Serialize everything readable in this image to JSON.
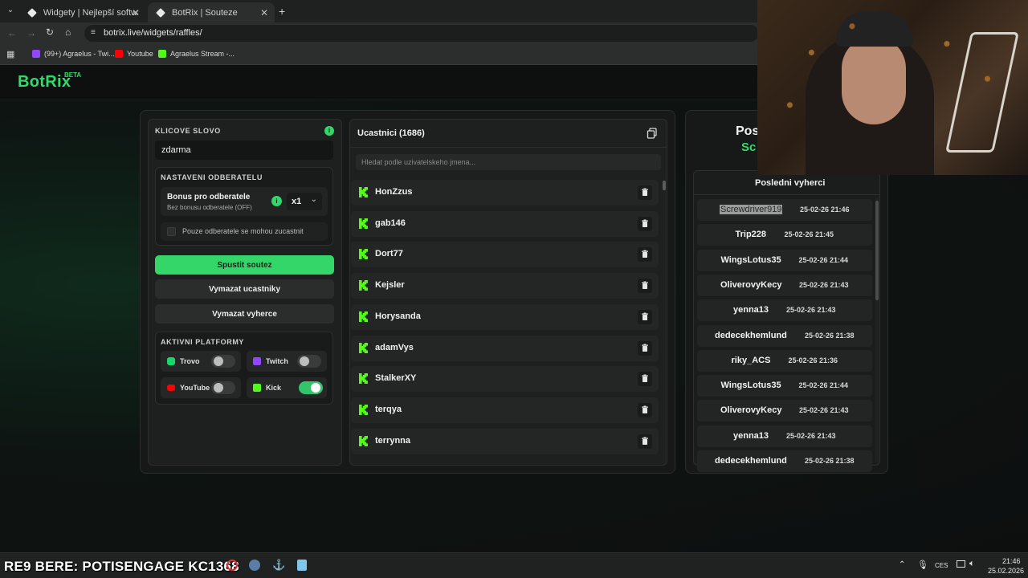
{
  "browser": {
    "tabs": [
      {
        "label": "Widgety | Nejlepší software pro",
        "active": false
      },
      {
        "label": "BotRix | Souteze",
        "active": true
      }
    ],
    "url": "botrix.live/widgets/raffles/",
    "bookmarks": [
      "(99+) Agraelus - Twi...",
      "Youtube",
      "Agraelus Stream -..."
    ]
  },
  "app": {
    "logo": "BotRix",
    "logo_badge": "BETA"
  },
  "left_panel": {
    "keyword_label": "KLICOVE SLOVO",
    "keyword_value": "zdarma",
    "subscriber_settings_label": "NASTAVENI ODBERATELU",
    "bonus_title": "Bonus pro odberatele",
    "bonus_subtitle": "Bez bonusu odberatele (OFF)",
    "bonus_multiplier": "x1",
    "subs_only_label": "Pouze odberatele se mohou zucastnit",
    "start_button": "Spustit soutez",
    "clear_participants_button": "Vymazat ucastniky",
    "clear_winners_button": "Vymazat vyherce",
    "platforms_label": "AKTIVNI PLATFORMY",
    "platforms": [
      {
        "name": "Trovo",
        "enabled": false,
        "color": "#19d66b"
      },
      {
        "name": "Twitch",
        "enabled": false,
        "color": "#9146ff"
      },
      {
        "name": "YouTube",
        "enabled": false,
        "color": "#ff0000"
      },
      {
        "name": "Kick",
        "enabled": true,
        "color": "#53fc18"
      }
    ]
  },
  "participants": {
    "title": "Ucastnici (1686)",
    "search_placeholder": "Hledat podle uzivatelskeho jmena...",
    "items": [
      "HonZzus",
      "gab146",
      "Dort77",
      "Kejsler",
      "Horysanda",
      "adamVys",
      "StalkerXY",
      "terqya",
      "terrynna"
    ]
  },
  "winners_panel": {
    "title_line1": "Pos",
    "title_line2": "Sc",
    "list_title": "Posledni vyherci",
    "items": [
      {
        "name": "Screwdriver919",
        "date": "25-02-26 21:46"
      },
      {
        "name": "Trip228",
        "date": "25-02-26 21:45"
      },
      {
        "name": "WingsLotus35",
        "date": "25-02-26 21:44"
      },
      {
        "name": "OliverovyKecy",
        "date": "25-02-26 21:43"
      },
      {
        "name": "yenna13",
        "date": "25-02-26 21:43"
      },
      {
        "name": "dedecekhemlund",
        "date": "25-02-26 21:38"
      },
      {
        "name": "riky_ACS",
        "date": "25-02-26 21:36"
      },
      {
        "name": "WingsLotus35",
        "date": "25-02-26 21:44"
      },
      {
        "name": "OliverovyKecy",
        "date": "25-02-26 21:43"
      },
      {
        "name": "yenna13",
        "date": "25-02-26 21:43"
      },
      {
        "name": "dedecekhemlund",
        "date": "25-02-26 21:38"
      }
    ]
  },
  "overlay_text": "RE9 BERE: POTISENGAGE KC1368",
  "taskbar": {
    "language": "CES",
    "time": "21:46",
    "date": "25.02.2026"
  }
}
